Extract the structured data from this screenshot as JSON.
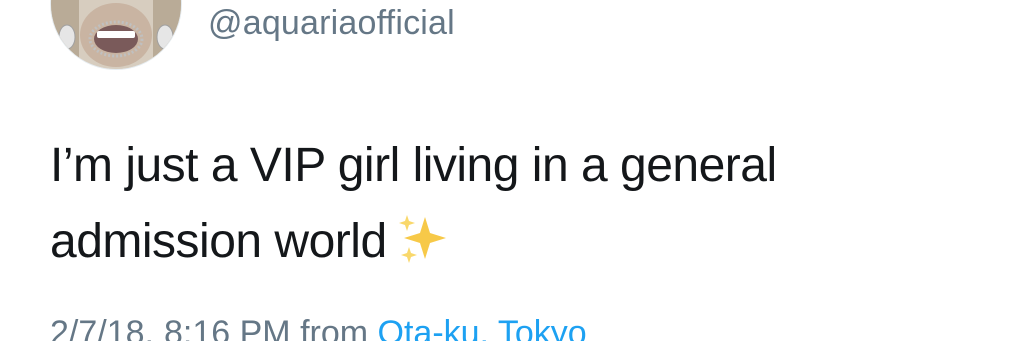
{
  "tweet": {
    "handle": "@aquariaofficial",
    "text_line_1": "I’m just a VIP girl living in a general",
    "text_line_2": "admission world",
    "emoji_icon": "sparkles-icon",
    "date": "2/7/18,",
    "time": "8:16 PM",
    "source_prefix": "from",
    "location": "Ota-ku, Tokyo"
  },
  "colors": {
    "text": "#14171a",
    "muted": "#657786",
    "link": "#1da1f2",
    "sparkle": "#f5c542"
  }
}
